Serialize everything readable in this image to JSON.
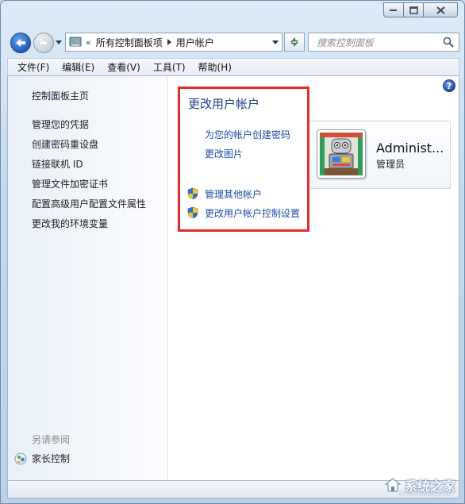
{
  "window": {
    "caption_buttons": [
      "minimize",
      "maximize",
      "close"
    ]
  },
  "navbar": {
    "breadcrumb": [
      "所有控制面板项",
      "用户帐户"
    ],
    "overflow_chevron": "«",
    "search_placeholder": "搜索控制面板"
  },
  "menubar": {
    "items": [
      "文件(F)",
      "编辑(E)",
      "查看(V)",
      "工具(T)",
      "帮助(H)"
    ]
  },
  "sidebar": {
    "home": "控制面板主页",
    "links": [
      "管理您的凭据",
      "创建密码重设盘",
      "链接联机 ID",
      "管理文件加密证书",
      "配置高级用户配置文件属性",
      "更改我的环境变量"
    ],
    "see_also_title": "另请参阅",
    "see_also_items": [
      "家长控制"
    ]
  },
  "main": {
    "title": "更改用户帐户",
    "links": [
      "为您的帐户创建密码",
      "更改图片"
    ],
    "shield_links": [
      "管理其他帐户",
      "更改用户帐户控制设置"
    ],
    "highlight_color": "#e02d2d"
  },
  "account": {
    "name": "Administ...",
    "role": "管理员"
  },
  "watermark": {
    "text": "系统之家",
    "sub": "XITONGZHIJIA.NET"
  }
}
